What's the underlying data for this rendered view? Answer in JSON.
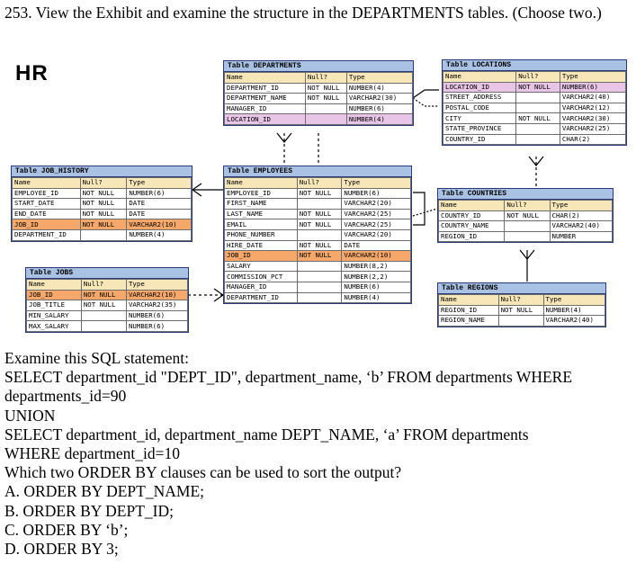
{
  "question": {
    "title": "253. View the Exhibit and examine the structure in the DEPARTMENTS tables. (Choose two.)"
  },
  "diagram": {
    "schema_label": "HR",
    "tables": {
      "departments": {
        "title": "Table DEPARTMENTS",
        "headers": [
          "Name",
          "Null?",
          "Type"
        ],
        "rows": [
          [
            "DEPARTMENT_ID",
            "NOT NULL",
            "NUMBER(4)"
          ],
          [
            "DEPARTMENT_NAME",
            "NOT NULL",
            "VARCHAR2(30)"
          ],
          [
            "MANAGER_ID",
            "",
            "NUMBER(6)"
          ],
          [
            "LOCATION_ID",
            "",
            "NUMBER(4)"
          ]
        ]
      },
      "locations": {
        "title": "Table LOCATIONS",
        "headers": [
          "Name",
          "Null?",
          "Type"
        ],
        "rows": [
          [
            "LOCATION_ID",
            "NOT NULL",
            "NUMBER(6)"
          ],
          [
            "STREET_ADDRESS",
            "",
            "VARCHAR2(40)"
          ],
          [
            "POSTAL_CODE",
            "",
            "VARCHAR2(12)"
          ],
          [
            "CITY",
            "NOT NULL",
            "VARCHAR2(30)"
          ],
          [
            "STATE_PROVINCE",
            "",
            "VARCHAR2(25)"
          ],
          [
            "COUNTRY_ID",
            "",
            "CHAR(2)"
          ]
        ]
      },
      "job_history": {
        "title": "Table JOB_HISTORY",
        "headers": [
          "Name",
          "Null?",
          "Type"
        ],
        "rows": [
          [
            "EMPLOYEE_ID",
            "NOT NULL",
            "NUMBER(6)"
          ],
          [
            "START_DATE",
            "NOT NULL",
            "DATE"
          ],
          [
            "END_DATE",
            "NOT NULL",
            "DATE"
          ],
          [
            "JOB_ID",
            "NOT NULL",
            "VARCHAR2(10)"
          ],
          [
            "DEPARTMENT_ID",
            "",
            "NUMBER(4)"
          ]
        ]
      },
      "employees": {
        "title": "Table EMPLOYEES",
        "headers": [
          "Name",
          "Null?",
          "Type"
        ],
        "rows": [
          [
            "EMPLOYEE_ID",
            "NOT NULL",
            "NUMBER(6)"
          ],
          [
            "FIRST_NAME",
            "",
            "VARCHAR2(20)"
          ],
          [
            "LAST_NAME",
            "NOT NULL",
            "VARCHAR2(25)"
          ],
          [
            "EMAIL",
            "NOT NULL",
            "VARCHAR2(25)"
          ],
          [
            "PHONE_NUMBER",
            "",
            "VARCHAR2(20)"
          ],
          [
            "HIRE_DATE",
            "NOT NULL",
            "DATE"
          ],
          [
            "JOB_ID",
            "NOT NULL",
            "VARCHAR2(10)"
          ],
          [
            "SALARY",
            "",
            "NUMBER(8,2)"
          ],
          [
            "COMMISSION_PCT",
            "",
            "NUMBER(2,2)"
          ],
          [
            "MANAGER_ID",
            "",
            "NUMBER(6)"
          ],
          [
            "DEPARTMENT_ID",
            "",
            "NUMBER(4)"
          ]
        ]
      },
      "countries": {
        "title": "Table COUNTRIES",
        "headers": [
          "Name",
          "Null?",
          "Type"
        ],
        "rows": [
          [
            "COUNTRY_ID",
            "NOT NULL",
            "CHAR(2)"
          ],
          [
            "COUNTRY_NAME",
            "",
            "VARCHAR2(40)"
          ],
          [
            "REGION_ID",
            "",
            "NUMBER"
          ]
        ]
      },
      "jobs": {
        "title": "Table JOBS",
        "headers": [
          "Name",
          "Null?",
          "Type"
        ],
        "rows": [
          [
            "JOB_ID",
            "NOT NULL",
            "VARCHAR2(10)"
          ],
          [
            "JOB_TITLE",
            "NOT NULL",
            "VARCHAR2(35)"
          ],
          [
            "MIN_SALARY",
            "",
            "NUMBER(6)"
          ],
          [
            "MAX_SALARY",
            "",
            "NUMBER(6)"
          ]
        ]
      },
      "regions": {
        "title": "Table REGIONS",
        "headers": [
          "Name",
          "Null?",
          "Type"
        ],
        "rows": [
          [
            "REGION_ID",
            "NOT NULL",
            "NUMBER(4)"
          ],
          [
            "REGION_NAME",
            "",
            "VARCHAR2(40)"
          ]
        ]
      }
    }
  },
  "body": {
    "examine": "Examine this SQL statement:",
    "sql_1": "SELECT department_id \"DEPT_ID\", department_name, ‘b’ FROM departments WHERE",
    "sql_2": "departments_id=90",
    "sql_3": "UNION",
    "sql_4": "SELECT department_id, department_name DEPT_NAME, ‘a’ FROM departments",
    "sql_5": "WHERE department_id=10",
    "prompt": "Which two ORDER BY clauses can be used to sort the output?",
    "options": [
      "A. ORDER BY DEPT_NAME;",
      "B. ORDER BY DEPT_ID;",
      "C. ORDER BY ‘b’;",
      "D. ORDER BY 3;"
    ]
  }
}
